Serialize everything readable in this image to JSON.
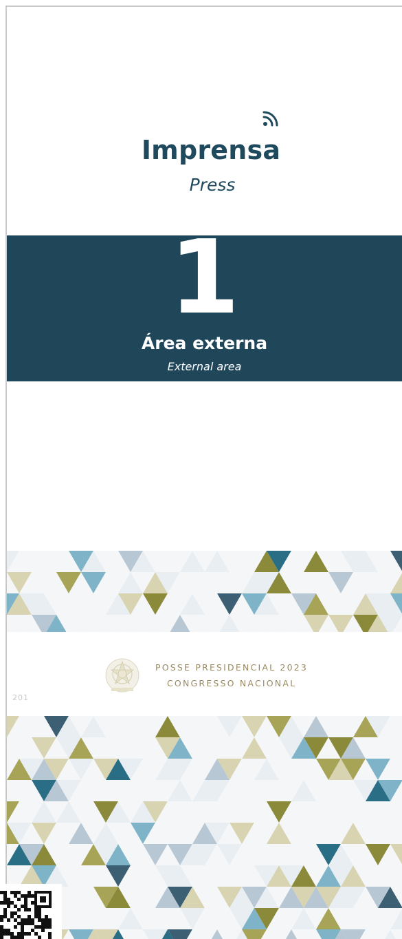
{
  "sign": {
    "title": "Imprensa",
    "subtitle": "Press",
    "icon": "rss-icon",
    "band": {
      "number": "1",
      "area_title": "Área externa",
      "area_subtitle": "External area",
      "color": "#20465a"
    }
  },
  "footer": {
    "event_line1": "POSSE PRESIDENCIAL 2023",
    "event_line2": "CONGRESSO NACIONAL",
    "page_number": "201"
  },
  "colors": {
    "title": "#1f4a5e",
    "gold": "#9b8a62",
    "pattern": [
      "#2a6e86",
      "#3c5f73",
      "#8a8a3a",
      "#a7a457",
      "#7fb4c8",
      "#b7c7d4",
      "#d8d4b2",
      "#e9eef2"
    ]
  }
}
